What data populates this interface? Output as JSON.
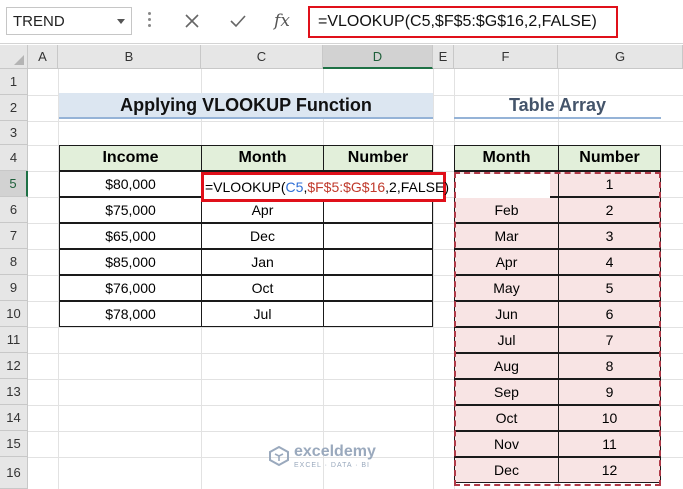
{
  "name_box": {
    "value": "TREND"
  },
  "formula_bar": {
    "fx_label": "fx",
    "formula": "=VLOOKUP(C5,$F$5:$G$16,2,FALSE)"
  },
  "columns": [
    "A",
    "B",
    "C",
    "D",
    "E",
    "F",
    "G"
  ],
  "rows": [
    "1",
    "2",
    "3",
    "4",
    "5",
    "6",
    "7",
    "8",
    "9",
    "10",
    "11",
    "12",
    "13",
    "14",
    "15",
    "16"
  ],
  "titles": {
    "left": "Applying VLOOKUP Function",
    "right": "Table Array"
  },
  "main_table": {
    "headers": [
      "Income",
      "Month",
      "Number"
    ],
    "rows": [
      {
        "income": "$80,000",
        "month": "",
        "number": ""
      },
      {
        "income": "$75,000",
        "month": "Apr",
        "number": ""
      },
      {
        "income": "$65,000",
        "month": "Dec",
        "number": ""
      },
      {
        "income": "$85,000",
        "month": "Jan",
        "number": ""
      },
      {
        "income": "$76,000",
        "month": "Oct",
        "number": ""
      },
      {
        "income": "$78,000",
        "month": "Jul",
        "number": ""
      }
    ]
  },
  "editing_cell": {
    "prefix": "=VLOOKUP(",
    "ref1": "C5",
    "sep1": ",",
    "ref2": "$F$5:$G$16",
    "suffix": ",2,FALSE)"
  },
  "lookup_table": {
    "headers": [
      "Month",
      "Number"
    ],
    "rows": [
      {
        "month": "",
        "number": "1"
      },
      {
        "month": "Feb",
        "number": "2"
      },
      {
        "month": "Mar",
        "number": "3"
      },
      {
        "month": "Apr",
        "number": "4"
      },
      {
        "month": "May",
        "number": "5"
      },
      {
        "month": "Jun",
        "number": "6"
      },
      {
        "month": "Jul",
        "number": "7"
      },
      {
        "month": "Aug",
        "number": "8"
      },
      {
        "month": "Sep",
        "number": "9"
      },
      {
        "month": "Oct",
        "number": "10"
      },
      {
        "month": "Nov",
        "number": "11"
      },
      {
        "month": "Dec",
        "number": "12"
      }
    ]
  },
  "watermark": {
    "name": "exceldemy",
    "tagline": "EXCEL · DATA · BI"
  },
  "colors": {
    "highlight_red": "#e0101a",
    "header_green": "#e2efda",
    "title_blue": "#dce6f1",
    "pink_fill": "#f8e4e4"
  }
}
